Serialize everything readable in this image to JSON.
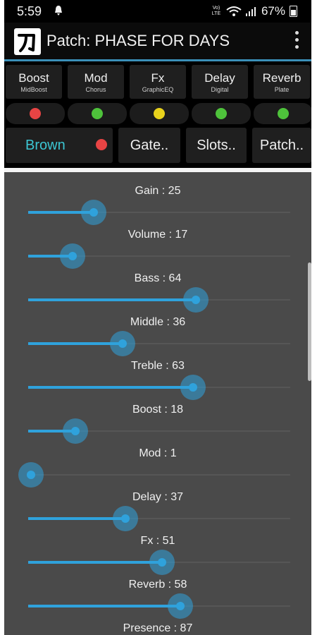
{
  "status": {
    "time": "5:59",
    "network": "Vo) LTE",
    "battery": "67%"
  },
  "appbar": {
    "title": "Patch: PHASE FOR DAYS"
  },
  "effects": [
    {
      "title": "Boost",
      "sub": "MidBoost",
      "led": "#e84444"
    },
    {
      "title": "Mod",
      "sub": "Chorus",
      "led": "#4ec23b"
    },
    {
      "title": "Fx",
      "sub": "GraphicEQ",
      "led": "#e8d21c"
    },
    {
      "title": "Delay",
      "sub": "Digital",
      "led": "#4ec23b"
    },
    {
      "title": "Reverb",
      "sub": "Plate",
      "led": "#4ec23b"
    }
  ],
  "nav": {
    "amp": "Brown",
    "amp_led": "#e84444",
    "gate": "Gate..",
    "slots": "Slots..",
    "patch": "Patch.."
  },
  "colors": {
    "accent": "#2fa2dc",
    "amp_text": "#3cc6d3"
  },
  "sliders": [
    {
      "label": "Gain : 25",
      "value": 25
    },
    {
      "label": "Volume : 17",
      "value": 17
    },
    {
      "label": "Bass : 64",
      "value": 64
    },
    {
      "label": "Middle : 36",
      "value": 36
    },
    {
      "label": "Treble : 63",
      "value": 63
    },
    {
      "label": "Boost : 18",
      "value": 18
    },
    {
      "label": "Mod : 1",
      "value": 1
    },
    {
      "label": "Delay : 37",
      "value": 37
    },
    {
      "label": "Fx : 51",
      "value": 51
    },
    {
      "label": "Reverb : 58",
      "value": 58
    },
    {
      "label": "Presence : 87",
      "value": 87
    }
  ]
}
